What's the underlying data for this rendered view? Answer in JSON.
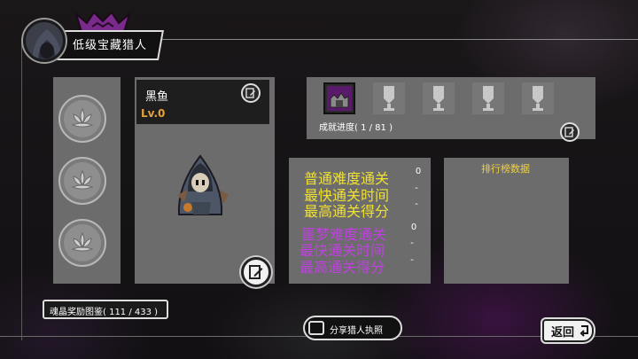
{
  "header": {
    "title": "低级宝藏猎人"
  },
  "character": {
    "name": "黑鱼",
    "level": "Lv.0"
  },
  "achievements": {
    "progress_label": "成就进度( 1 / 81 )",
    "slots": [
      "unlocked",
      "locked",
      "locked",
      "locked",
      "locked"
    ]
  },
  "stats": {
    "normal": [
      {
        "label": "普通难度通关",
        "value": "0"
      },
      {
        "label": "最快通关时间",
        "value": "-"
      },
      {
        "label": "最高通关得分",
        "value": "-"
      }
    ],
    "nightmare": [
      {
        "label": "噩梦难度通关",
        "value": "0"
      },
      {
        "label": "最快通关时间",
        "value": "-"
      },
      {
        "label": "最高通关得分",
        "value": "-"
      }
    ]
  },
  "leaderboard": {
    "title": "排行榜数据"
  },
  "footer": {
    "soul_crystal_label": "魂晶奖励图鉴( 111 / 433 )",
    "share_label": "分享猎人执照",
    "back_label": "返回"
  },
  "colors": {
    "accent_yellow": "#f0e030",
    "accent_purple": "#c040e0",
    "level_orange": "#e8a23a",
    "panel_gray": "#6c6c6c"
  }
}
